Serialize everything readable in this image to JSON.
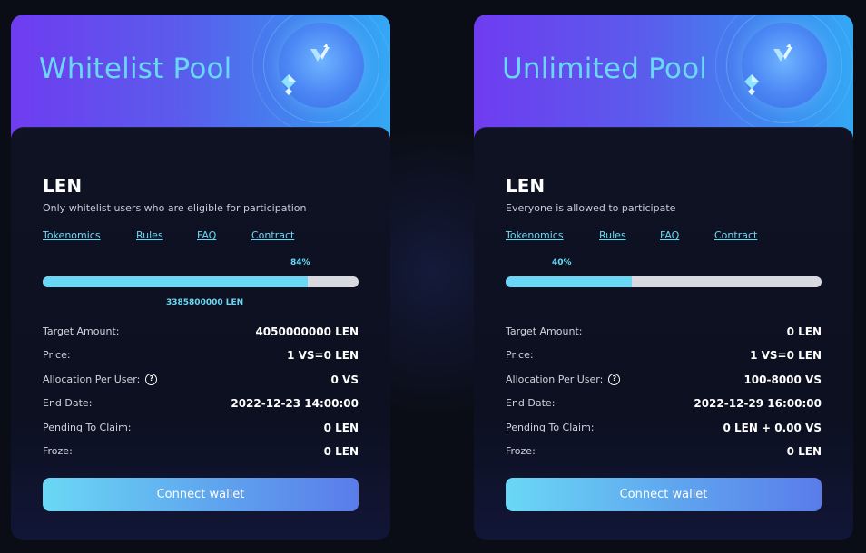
{
  "pools": [
    {
      "title": "Whitelist Pool",
      "token": "LEN",
      "subtitle": "Only whitelist users who are eligible for participation",
      "links": [
        "Tokenomics",
        "Rules",
        "FAQ",
        "Contract"
      ],
      "progress_percent": 84,
      "progress_label": "84%",
      "raised_label": "3385800000 LEN",
      "rows": [
        {
          "label": "Target Amount:",
          "value": "4050000000 LEN"
        },
        {
          "label": "Price:",
          "value": "1 VS=0 LEN"
        },
        {
          "label": "Allocation Per User:",
          "value": "0 VS",
          "help_icon": "question-circle-icon"
        },
        {
          "label": "End Date:",
          "value": "2022-12-23 14:00:00"
        },
        {
          "label": "Pending To Claim:",
          "value": "0 LEN"
        },
        {
          "label": "Froze:",
          "value": "0 LEN"
        }
      ],
      "button_label": "Connect wallet"
    },
    {
      "title": "Unlimited Pool",
      "token": "LEN",
      "subtitle": "Everyone is allowed to participate",
      "links": [
        "Tokenomics",
        "Rules",
        "FAQ",
        "Contract"
      ],
      "progress_percent": 40,
      "progress_label": "40%",
      "raised_label": "",
      "rows": [
        {
          "label": "Target Amount:",
          "value": "0 LEN"
        },
        {
          "label": "Price:",
          "value": "1 VS=0 LEN"
        },
        {
          "label": "Allocation Per User:",
          "value": "100-8000 VS",
          "help_icon": "question-circle-icon"
        },
        {
          "label": "End Date:",
          "value": "2022-12-29 16:00:00"
        },
        {
          "label": "Pending To Claim:",
          "value": "0 LEN + 0.00 VS"
        },
        {
          "label": "Froze:",
          "value": "0 LEN"
        }
      ],
      "button_label": "Connect wallet"
    }
  ],
  "colors": {
    "accent": "#6ad8f5",
    "banner_start": "#6f3cf0",
    "banner_end": "#34a8f4",
    "card_bg": "#0d1120",
    "page_bg": "#0b0d16",
    "bar_track": "#d9dadf"
  },
  "icons": {
    "banner_logo": "v-logo-icon",
    "banner_gem": "diamond-gem-icon",
    "help": "question-circle-icon"
  }
}
